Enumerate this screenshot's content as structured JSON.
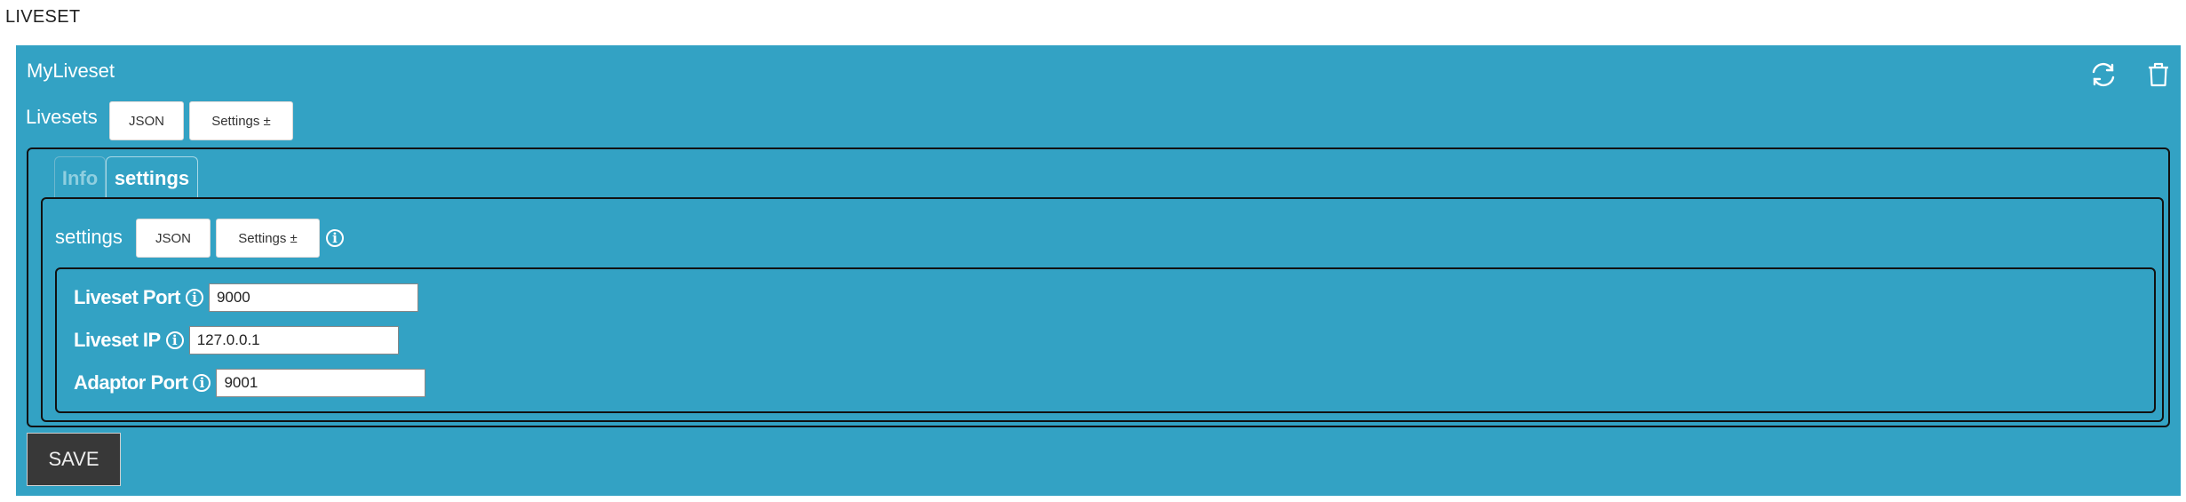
{
  "page": {
    "title": "LIVESET"
  },
  "panel": {
    "title": "MyLiveset",
    "icons": {
      "refresh": "refresh-icon",
      "delete": "trash-icon"
    },
    "toolbar": {
      "label": "Livesets",
      "json_button": "JSON",
      "settings_button": "Settings ±"
    }
  },
  "tabs": [
    {
      "label": "Info",
      "active": false
    },
    {
      "label": "settings",
      "active": true
    }
  ],
  "settings_section": {
    "label": "settings",
    "json_button": "JSON",
    "settings_button": "Settings ±",
    "info_glyph": "i"
  },
  "fields": [
    {
      "label": "Liveset Port",
      "value": "9000",
      "info_glyph": "i"
    },
    {
      "label": "Liveset IP",
      "value": "127.0.0.1",
      "info_glyph": "i"
    },
    {
      "label": "Adaptor Port",
      "value": "9001",
      "info_glyph": "i"
    }
  ],
  "actions": {
    "save_label": "SAVE"
  },
  "colors": {
    "panel_bg": "#33a2c4",
    "save_bg": "#383838"
  }
}
